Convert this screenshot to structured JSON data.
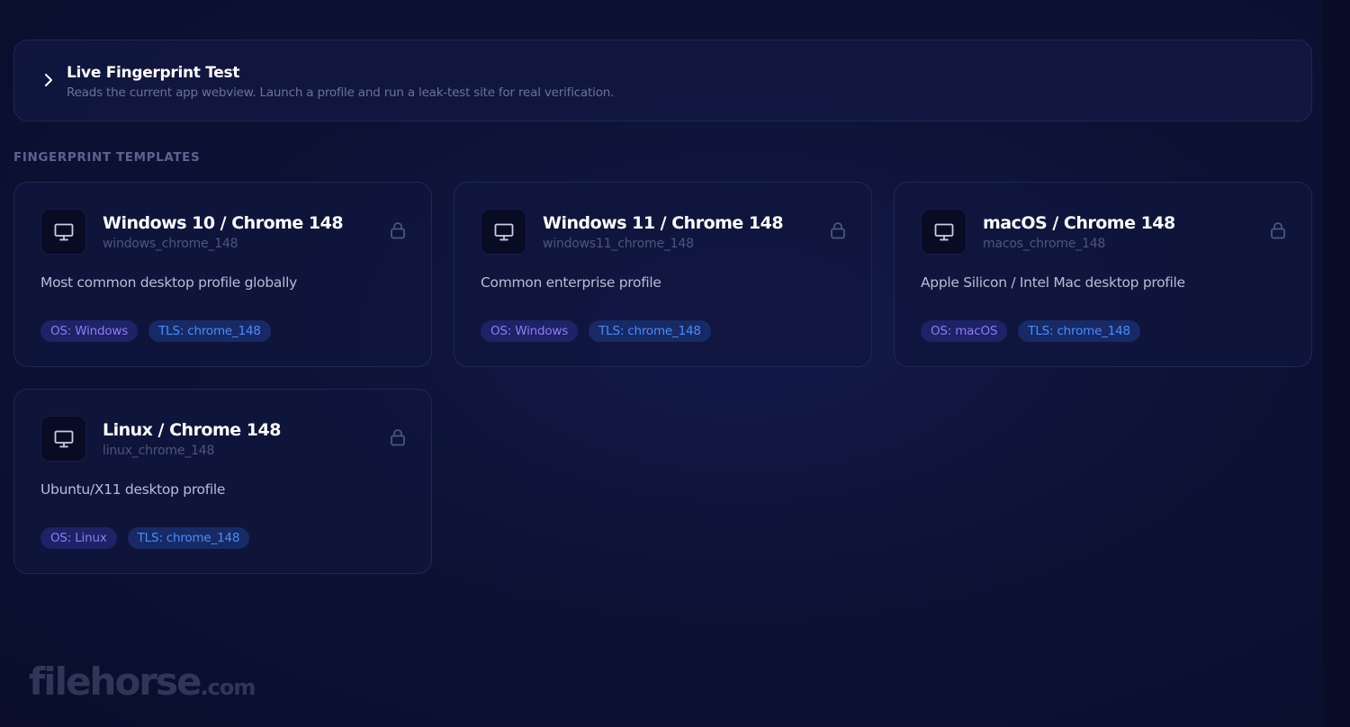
{
  "live_test": {
    "title": "Live Fingerprint Test",
    "subtitle": "Reads the current app webview. Launch a profile and run a leak-test site for real verification."
  },
  "section": {
    "label": "FINGERPRINT TEMPLATES"
  },
  "templates": [
    {
      "title": "Windows 10 / Chrome 148",
      "slug": "windows_chrome_148",
      "description": "Most common desktop profile globally",
      "os_tag": "OS: Windows",
      "tls_tag": "TLS: chrome_148"
    },
    {
      "title": "Windows 11 / Chrome 148",
      "slug": "windows11_chrome_148",
      "description": "Common enterprise profile",
      "os_tag": "OS: Windows",
      "tls_tag": "TLS: chrome_148"
    },
    {
      "title": "macOS / Chrome 148",
      "slug": "macos_chrome_148",
      "description": "Apple Silicon / Intel Mac desktop profile",
      "os_tag": "OS: macOS",
      "tls_tag": "TLS: chrome_148"
    },
    {
      "title": "Linux / Chrome 148",
      "slug": "linux_chrome_148",
      "description": "Ubuntu/X11 desktop profile",
      "os_tag": "OS: Linux",
      "tls_tag": "TLS: chrome_148"
    }
  ],
  "icons": {
    "expand": "chevron-right-icon",
    "template": "monitor-icon",
    "locked": "lock-icon"
  },
  "colors": {
    "background": "#0d1236",
    "os_tag_text": "#8f7cf0",
    "tls_tag_text": "#4b8cf5"
  },
  "watermark": {
    "text": "filehorse",
    "suffix": ".com"
  }
}
